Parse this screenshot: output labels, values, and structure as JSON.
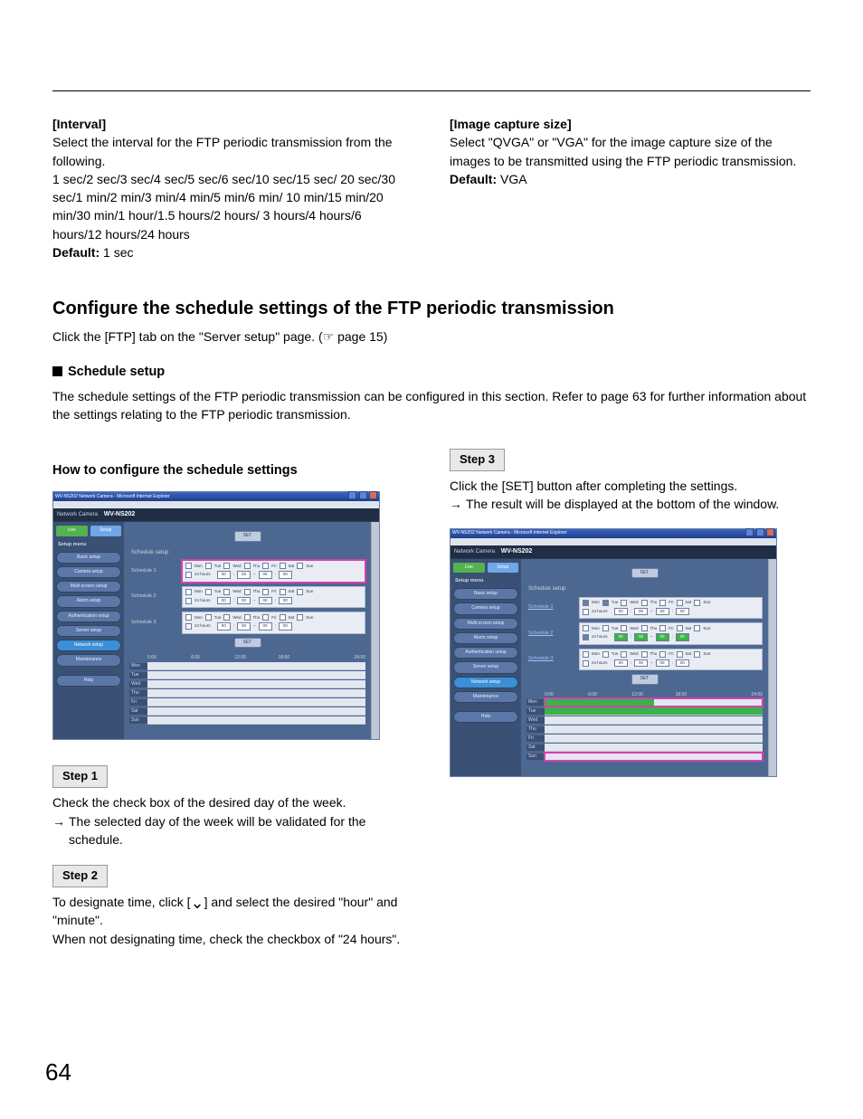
{
  "interval_block": {
    "heading": "[Interval]",
    "p1": "Select the interval for the FTP periodic transmission from the following.",
    "p2": "1 sec/2 sec/3 sec/4 sec/5 sec/6 sec/10 sec/15 sec/ 20 sec/30 sec/1 min/2 min/3 min/4 min/5 min/6 min/ 10 min/15 min/20 min/30 min/1 hour/1.5 hours/2 hours/ 3 hours/4 hours/6 hours/12 hours/24 hours",
    "default_label": "Default:",
    "default_value": " 1 sec"
  },
  "image_block": {
    "heading": "[Image capture size]",
    "p1": "Select \"QVGA\" or \"VGA\" for the image capture size of the images to be transmitted using the FTP periodic transmission.",
    "default_label": "Default:",
    "default_value": " VGA"
  },
  "section_title": "Configure the schedule settings of the FTP periodic transmission",
  "section_intro_a": "Click the [FTP] tab on the \"Server setup\" page. (",
  "section_intro_ref": "☞",
  "section_intro_b": " page 15)",
  "schedule_head": "Schedule setup",
  "schedule_body": "The schedule settings of the FTP periodic transmission can be configured in this section. Refer to page 63 for further information about the settings relating to the FTP periodic transmission.",
  "howto_head": "How to configure the schedule settings",
  "step1": {
    "label": "Step 1",
    "line1": "Check the check box of the desired day of the week.",
    "line2": "The selected day of the week will be validated for the schedule."
  },
  "step2": {
    "label": "Step 2",
    "line1a": "To designate time, click [",
    "line1b": "] and select the desired \"hour\" and \"minute\".",
    "line2": "When not designating time, check the checkbox of \"24 hours\"."
  },
  "step3": {
    "label": "Step 3",
    "line1": "Click the [SET] button after completing the settings.",
    "line2": "The result will be displayed at the bottom of the window."
  },
  "browser": {
    "title": "WV-NS202 Network Camera - Microsoft Internet Explorer",
    "brand": "Network Camera",
    "model": "WV-NS202",
    "tabs": {
      "live": "Live",
      "setup": "Setup"
    },
    "menu_title": "Setup menu",
    "menu": [
      "Basic setup",
      "Camera setup",
      "Multi-screen setup",
      "Alarm setup",
      "Authentication setup",
      "Server setup",
      "Network setup",
      "Maintenance",
      "Help"
    ],
    "panel_title": "Schedule setup",
    "sched": [
      "Schedule 1",
      "Schedule 2",
      "Schedule 3"
    ],
    "days": [
      "Mon",
      "Tue",
      "Wed",
      "Thu",
      "Fri",
      "Sat",
      "Sun"
    ],
    "h24": "24 hours",
    "set": "SET",
    "tl_days": [
      "Mon",
      "Tue",
      "Wed",
      "Thu",
      "Fri",
      "Sat",
      "Sun"
    ],
    "tl_ticks": [
      "0:00",
      "6:00",
      "12:00",
      "18:00",
      "24:00"
    ],
    "time_sel": [
      "00",
      "00",
      "00",
      "00"
    ]
  },
  "page_number": "64"
}
